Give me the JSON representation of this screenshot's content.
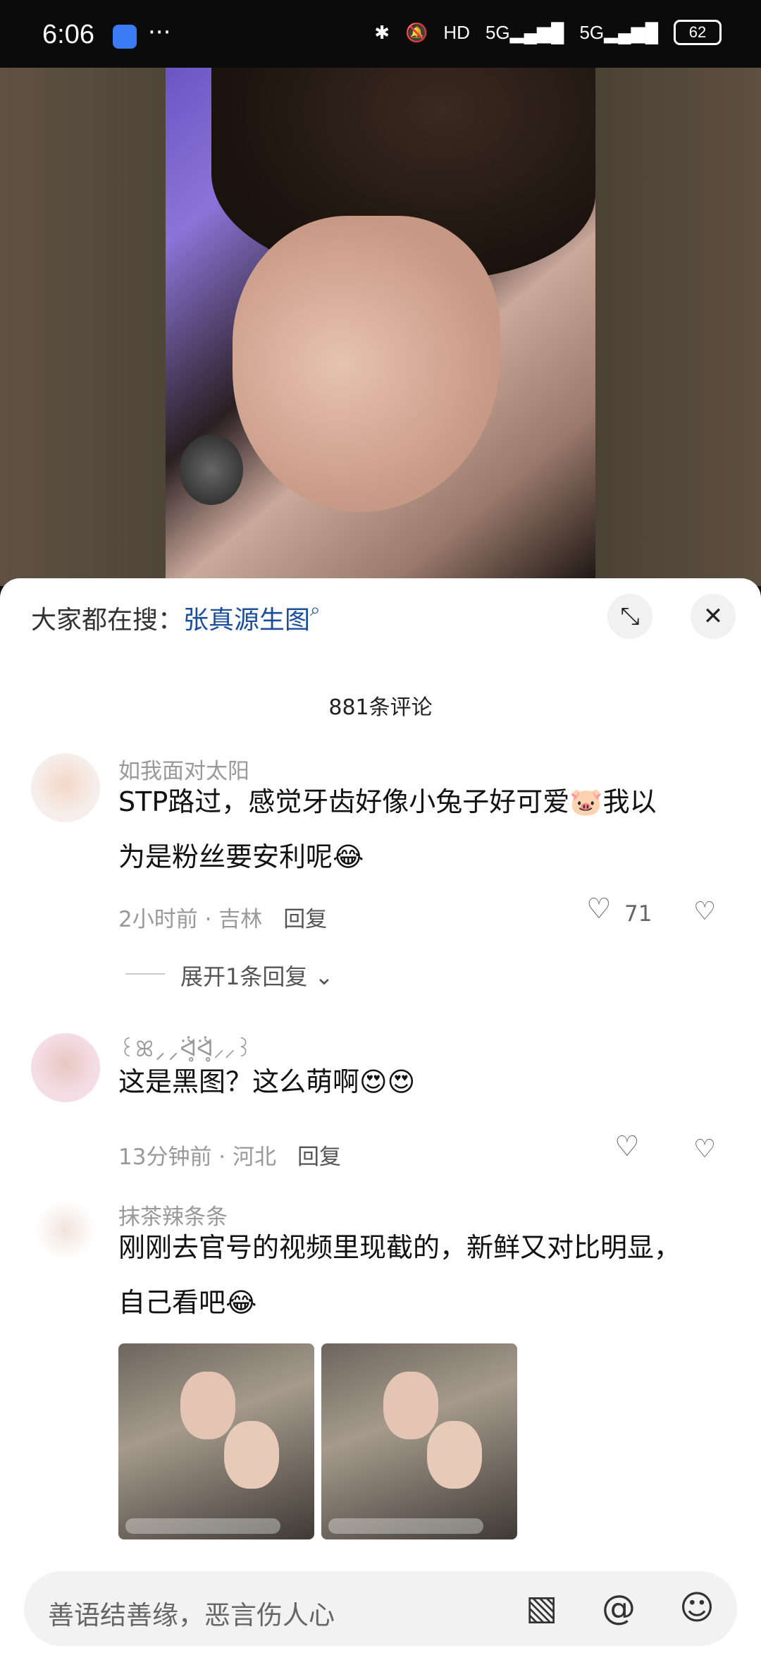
{
  "status_bar": {
    "time": "6:06",
    "more": "···",
    "hd": "HD",
    "net1": "5G",
    "net2": "5G",
    "battery": "62"
  },
  "sheet": {
    "search_prefix": "大家都在搜：",
    "search_term": "张真源生图",
    "comment_count": "881条评论"
  },
  "comments": [
    {
      "username": "如我面对太阳",
      "text_line1": "STP路过，感觉牙齿好像小兔子好可爱🐷我以",
      "text_line2": "为是粉丝要安利呢😂",
      "time_loc": "2小时前 · 吉林",
      "reply": "回复",
      "likes": "71",
      "expand": "展开1条回复"
    },
    {
      "username": "꒰ꕤ⸝⸝ᐛ̥̆ᐛ̥̆⸝⸝꒱",
      "text": "这是黑图？这么萌啊😍😍",
      "time_loc": "13分钟前 · 河北",
      "reply": "回复"
    },
    {
      "username": "抹茶辣条条",
      "text_line1": "刚刚去官号的视频里现截的，新鲜又对比明显，",
      "text_line2": "自己看吧😂"
    }
  ],
  "input": {
    "placeholder": "善语结善缘，恶言伤人心"
  },
  "icons": {
    "close": "✕",
    "expand": "⤡",
    "heart": "♡",
    "dislike": "♡",
    "chevron": "⌄",
    "image": "▧",
    "at": "@",
    "emoji": "☺",
    "search": "🔍"
  }
}
